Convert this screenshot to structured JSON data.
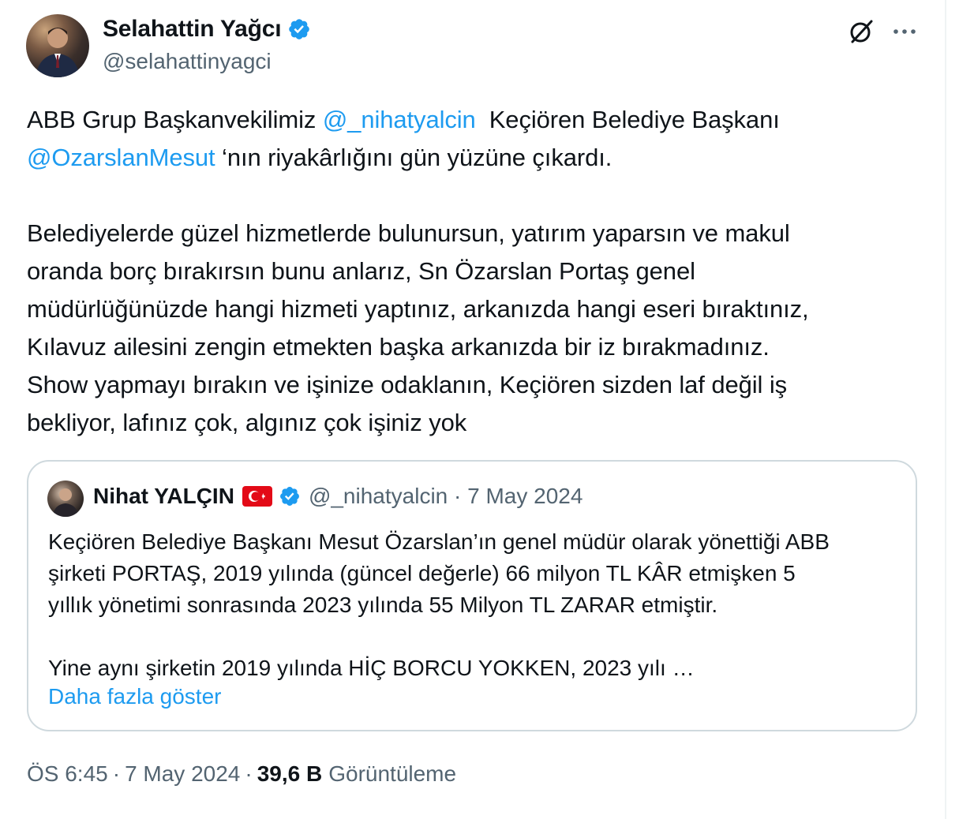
{
  "author": {
    "display_name": "Selahattin Yağcı",
    "handle": "@selahattinyagci"
  },
  "tweet": {
    "mention_1": "@_nihatyalcin",
    "mention_2": "@OzarslanMesut",
    "line1_prefix": "ABB Grup Başkanvekilimiz ",
    "line1_suffix": "  Keçiören Belediye Başkanı",
    "line2_suffix": " ‘nın riyakârlığını gün yüzüne çıkardı.",
    "paragraph_2": "Belediyelerde güzel hizmetlerde bulunursun, yatırım yaparsın ve makul\noranda borç bırakırsın bunu anlarız, Sn Özarslan Portaş genel\nmüdürlüğünüzde hangi hizmeti yaptınız, arkanızda hangi eseri bıraktınız,\nKılavuz ailesini zengin etmekten başka arkanızda bir iz bırakmadınız.\nShow yapmayı bırakın ve işinize odaklanın, Keçiören sizden laf değil iş\nbekliyor, lafınız çok, algınız çok işiniz yok"
  },
  "quote": {
    "display_name": "Nihat YALÇIN",
    "handle_date": "@_nihatyalcin · 7 May 2024",
    "text": "Keçiören Belediye Başkanı Mesut Özarslan’ın genel müdür olarak yönettiği ABB\nşirketi PORTAŞ, 2019 yılında (güncel değerle) 66 milyon TL KÂR etmişken 5\nyıllık yönetimi sonrasında 2023 yılında 55 Milyon TL ZARAR etmiştir.\n\nYine aynı şirketin 2019 yılında HİÇ BORCU YOKKEN, 2023 yılı …",
    "show_more": "Daha fazla göster"
  },
  "footer": {
    "time": "ÖS 6:45",
    "date": "7 May 2024",
    "separator": "·",
    "views_count": "39,6 B",
    "views_label": "Görüntüleme"
  },
  "colors": {
    "link": "#1d9bf0",
    "secondary_text": "#536471",
    "border": "#cfd9de",
    "flag_red": "#e30a17"
  },
  "icons": [
    "verified-badge-icon",
    "grok-icon",
    "more-icon",
    "turkey-flag-icon"
  ]
}
